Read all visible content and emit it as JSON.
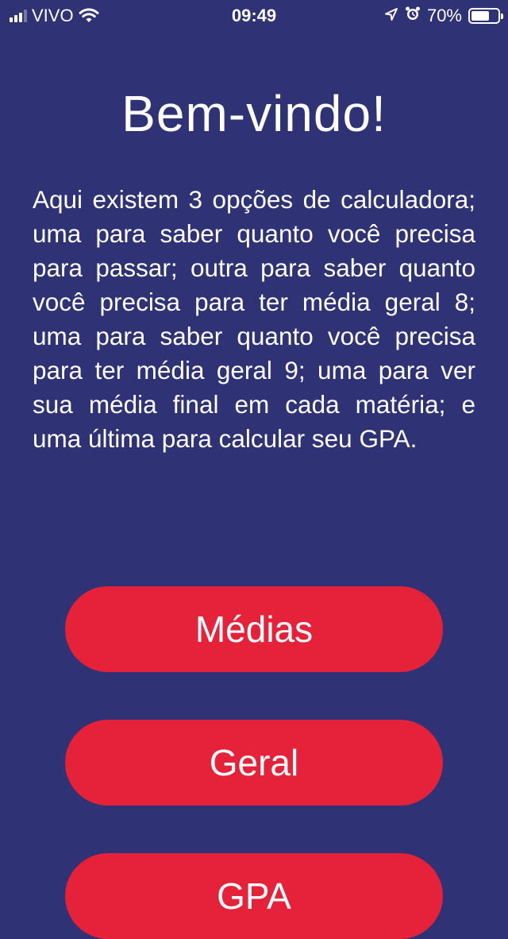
{
  "status_bar": {
    "carrier": "VIVO",
    "time": "09:49",
    "battery_percent": "70%",
    "battery_level": 0.7,
    "signal_bars_active": 3,
    "signal_bars_total": 4,
    "icons": [
      "signal-icon",
      "wifi-icon",
      "location-arrow-icon",
      "alarm-clock-icon",
      "battery-icon"
    ]
  },
  "main": {
    "title": "Bem-vindo!",
    "description": "Aqui existem 3 opções de calculadora; uma para saber quanto você precisa para passar; outra para saber quanto você precisa para ter média geral 8; uma para saber quanto você precisa para ter média geral 9; uma para ver sua média final em cada matéria; e uma última para calcular seu GPA.",
    "buttons": {
      "medias": "Médias",
      "geral": "Geral",
      "gpa": "GPA"
    }
  },
  "colors": {
    "background": "#2f3275",
    "button": "#e5223a",
    "text": "#ffffff"
  }
}
